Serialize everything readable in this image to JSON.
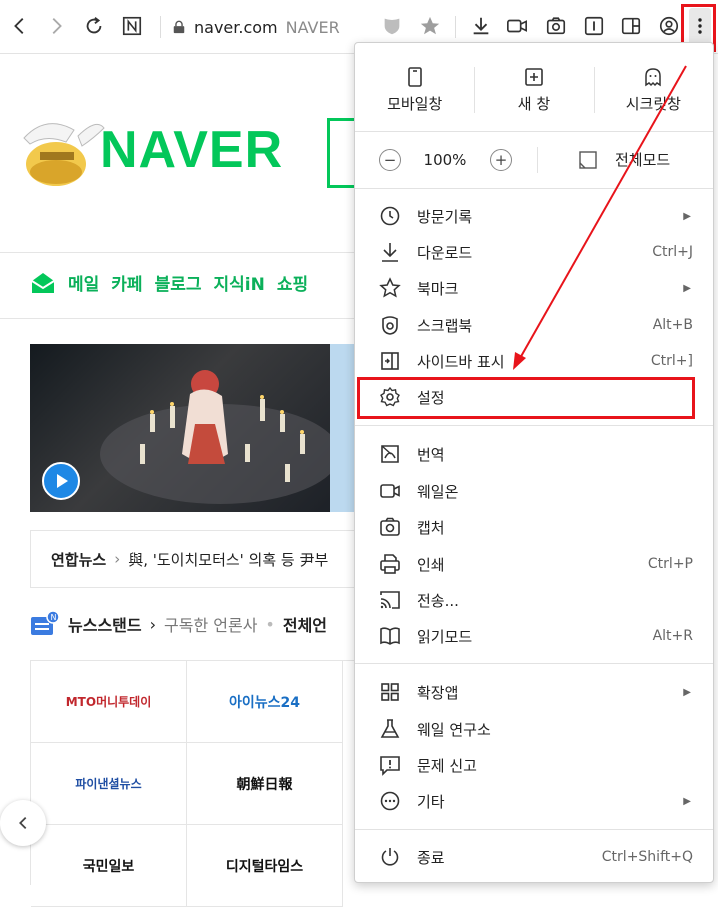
{
  "toolbar": {
    "address_host": "naver.com",
    "address_site": "NAVER"
  },
  "page": {
    "logo_text": "NAVER",
    "services": [
      "메일",
      "카페",
      "블로그",
      "지식iN",
      "쇼핑"
    ],
    "news": {
      "source": "연합뉴스",
      "headline": "與, '도이치모터스' 의혹 등 尹부"
    },
    "newsstand": {
      "title": "뉴스스탠드",
      "subscribed": "구독한 언론사",
      "all": "전체언"
    },
    "press": [
      {
        "name": "MTO머니투데이",
        "color": "#c1272d"
      },
      {
        "name": "아이뉴스24",
        "color": "#1a6fc4"
      },
      {
        "name": "파이낸셜뉴스",
        "color": "#1f4ea3"
      },
      {
        "name": "朝鮮日報",
        "color": "#111111"
      },
      {
        "name": "국민일보",
        "color": "#111111"
      },
      {
        "name": "디지털타임스",
        "color": "#111111"
      }
    ]
  },
  "menu": {
    "quick": [
      {
        "label": "모바일창",
        "icon": "mobile-window-icon"
      },
      {
        "label": "새 창",
        "icon": "new-window-icon"
      },
      {
        "label": "시크릿창",
        "icon": "secret-window-icon"
      }
    ],
    "zoom": {
      "minus": "−",
      "value": "100%",
      "plus": "+",
      "fullscreen_label": "전체모드"
    },
    "items": [
      {
        "label": "방문기록",
        "shortcut": "",
        "submenu": true,
        "icon": "clock-icon"
      },
      {
        "label": "다운로드",
        "shortcut": "Ctrl+J",
        "submenu": false,
        "icon": "download-icon"
      },
      {
        "label": "북마크",
        "shortcut": "",
        "submenu": true,
        "icon": "star-icon"
      },
      {
        "label": "스크랩북",
        "shortcut": "Alt+B",
        "submenu": false,
        "icon": "scrapbook-icon"
      },
      {
        "label": "사이드바 표시",
        "shortcut": "Ctrl+]",
        "submenu": false,
        "icon": "sidebar-icon"
      },
      {
        "label": "설정",
        "shortcut": "",
        "submenu": false,
        "icon": "gear-icon"
      },
      {
        "label": "번역",
        "shortcut": "",
        "submenu": false,
        "icon": "translate-icon"
      },
      {
        "label": "웨일온",
        "shortcut": "",
        "submenu": false,
        "icon": "video-icon"
      },
      {
        "label": "캡처",
        "shortcut": "",
        "submenu": false,
        "icon": "camera-icon"
      },
      {
        "label": "인쇄",
        "shortcut": "Ctrl+P",
        "submenu": false,
        "icon": "print-icon"
      },
      {
        "label": "전송...",
        "shortcut": "",
        "submenu": false,
        "icon": "cast-icon"
      },
      {
        "label": "읽기모드",
        "shortcut": "Alt+R",
        "submenu": false,
        "icon": "book-icon"
      },
      {
        "label": "확장앱",
        "shortcut": "",
        "submenu": true,
        "icon": "extensions-icon"
      },
      {
        "label": "웨일 연구소",
        "shortcut": "",
        "submenu": false,
        "icon": "flask-icon"
      },
      {
        "label": "문제 신고",
        "shortcut": "",
        "submenu": false,
        "icon": "report-icon"
      },
      {
        "label": "기타",
        "shortcut": "",
        "submenu": true,
        "icon": "more-icon"
      },
      {
        "label": "종료",
        "shortcut": "Ctrl+Shift+Q",
        "submenu": false,
        "icon": "power-icon"
      }
    ]
  },
  "colors": {
    "naver_green": "#03c75a",
    "highlight_red": "#e8141b"
  }
}
